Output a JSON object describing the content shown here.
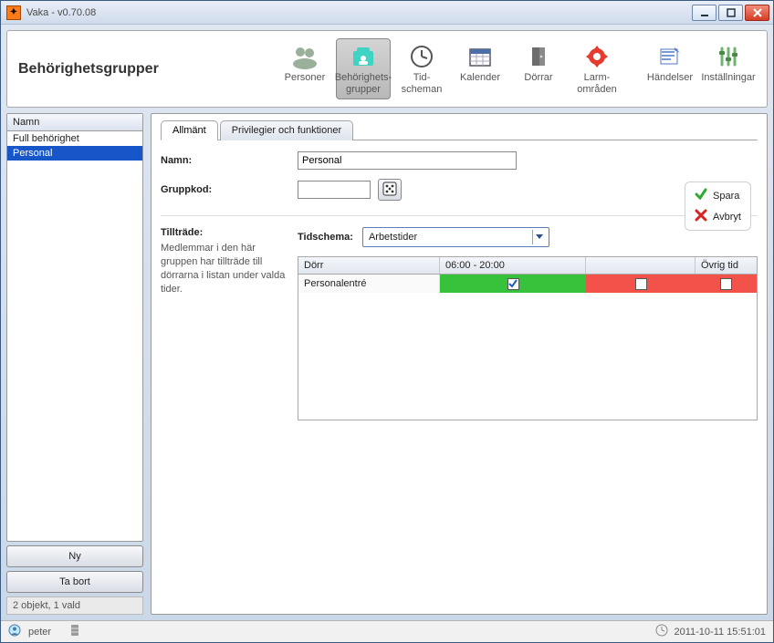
{
  "window": {
    "title": "Vaka - v0.70.08"
  },
  "pageTitle": "Behörighetsgrupper",
  "toolbar": {
    "items": [
      {
        "id": "personer",
        "label": "Personer"
      },
      {
        "id": "behorighetsgrupper",
        "label": "Behörighets-\ngrupper",
        "active": true
      },
      {
        "id": "tidscheman",
        "label": "Tid-\nscheman"
      },
      {
        "id": "kalender",
        "label": "Kalender"
      },
      {
        "id": "dorrar",
        "label": "Dörrar"
      },
      {
        "id": "larm",
        "label": "Larm-\nområden"
      },
      {
        "id": "handelser",
        "label": "Händelser"
      },
      {
        "id": "installningar",
        "label": "Inställningar"
      }
    ]
  },
  "sidebar": {
    "header": "Namn",
    "items": [
      {
        "label": "Full behörighet"
      },
      {
        "label": "Personal",
        "selected": true
      }
    ],
    "newLabel": "Ny",
    "deleteLabel": "Ta bort",
    "status": "2 objekt, 1 vald"
  },
  "tabs": {
    "allmant": "Allmänt",
    "privs": "Privilegier och funktioner"
  },
  "form": {
    "nameLabel": "Namn:",
    "nameValue": "Personal",
    "groupCodeLabel": "Gruppkod:",
    "groupCodeValue": "",
    "accessLabel": "Tillträde:",
    "accessHelp": "Medlemmar i den här gruppen har tillträde till dörrarna i listan under valda tider.",
    "scheduleLabel": "Tidschema:",
    "scheduleValue": "Arbetstider"
  },
  "actions": {
    "save": "Spara",
    "cancel": "Avbryt"
  },
  "accessTable": {
    "cols": {
      "door": "Dörr",
      "time1": "06:00 - 20:00",
      "time2": "",
      "rest": "Övrig tid"
    },
    "rows": [
      {
        "door": "Personalentré",
        "time1": true,
        "time2": false,
        "rest": false
      }
    ]
  },
  "statusbar": {
    "user": "peter",
    "datetime": "2011-10-11 15:51:01"
  }
}
